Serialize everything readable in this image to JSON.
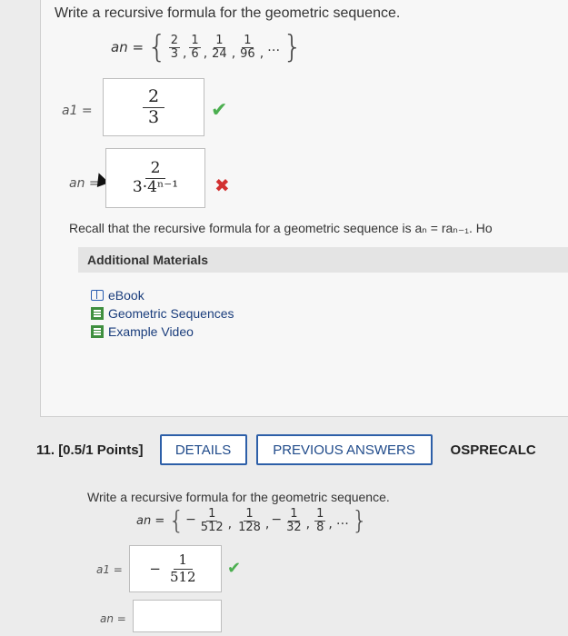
{
  "q10": {
    "title": "Write a recursive formula for the geometric sequence.",
    "seq_lhs": "an =",
    "terms": [
      {
        "num": "2",
        "den": "3"
      },
      {
        "num": "1",
        "den": "6"
      },
      {
        "num": "1",
        "den": "24"
      },
      {
        "num": "1",
        "den": "96"
      }
    ],
    "a1_label": "a1 =",
    "a1_answer": {
      "num": "2",
      "den": "3"
    },
    "an_label": "an =",
    "an_answer": {
      "num": "2",
      "den": "3·4ⁿ⁻¹"
    },
    "hint_text": "Recall that the recursive formula for a geometric sequence is aₙ = raₙ₋₁. Ho",
    "additional_materials": "Additional Materials",
    "links": [
      "eBook",
      "Geometric Sequences",
      "Example Video"
    ]
  },
  "q11": {
    "number": "11. [0.5/1 Points]",
    "details_btn": "DETAILS",
    "prev_btn": "PREVIOUS ANSWERS",
    "course": "OSPRECALC",
    "title": "Write a recursive formula for the geometric sequence.",
    "seq_lhs": "an =",
    "terms": [
      {
        "sign": "−",
        "num": "1",
        "den": "512"
      },
      {
        "sign": "",
        "num": "1",
        "den": "128"
      },
      {
        "sign": "−",
        "num": "1",
        "den": "32"
      },
      {
        "sign": "",
        "num": "1",
        "den": "8"
      }
    ],
    "a1_label": "a1 =",
    "a1_answer": {
      "sign": "−",
      "num": "1",
      "den": "512"
    },
    "an_label": "an ="
  },
  "colors": {
    "correct": "#4caf50",
    "incorrect": "#d23030",
    "button_border": "#2d5fa8"
  }
}
